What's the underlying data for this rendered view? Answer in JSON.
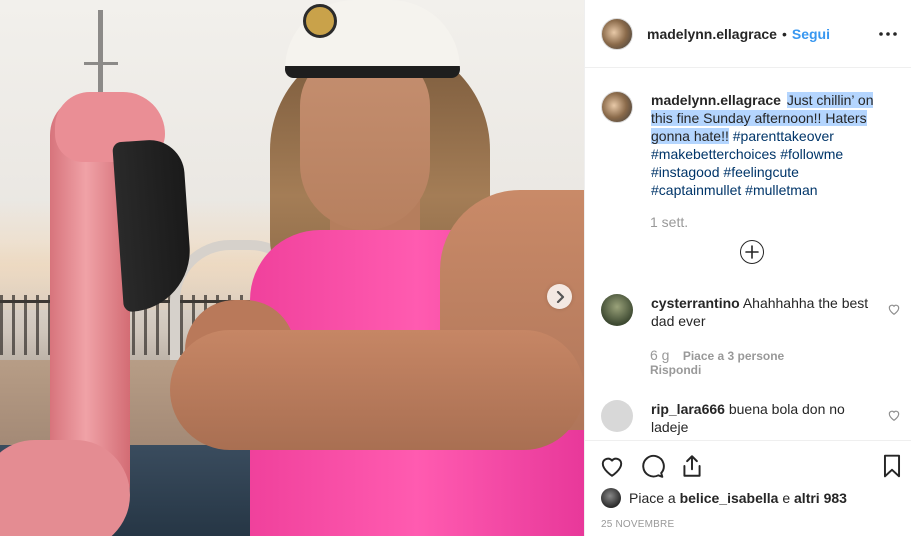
{
  "post": {
    "username": "madelynn.ellagrace",
    "separator": "•",
    "follow_label": "Segui",
    "caption": {
      "username": "madelynn.ellagrace",
      "highlighted_text_1": "Just chillin’ on this fine Sunday afternoon!! Haters gonna hate!!",
      "hashtags": [
        "#parenttakeover",
        "#makebetterchoices",
        "#followme",
        "#instagood",
        "#feelingcute",
        "#captainmullet",
        "#mulletman"
      ],
      "time": "1 sett."
    },
    "comments": [
      {
        "username": "cysterrantino",
        "text": "Ahahhahha the best dad ever",
        "age": "6 g",
        "likes": "Piace a 3 persone",
        "reply_label": "Rispondi"
      },
      {
        "username": "rip_lara666",
        "text": "buena bola don no ladeje"
      }
    ],
    "liked_by": {
      "prefix": "Piace a",
      "user": "belice_isabella",
      "connector": "e",
      "others": "altri 983"
    },
    "date": "25 novembre"
  },
  "icons": {
    "more": "more-icon",
    "next": "chevron-right-icon",
    "load_more": "plus-circle-icon",
    "like": "heart-icon",
    "comment": "comment-icon",
    "share": "share-icon",
    "save": "bookmark-icon"
  },
  "colors": {
    "follow": "#3897f0",
    "hashtag": "#003569",
    "selection": "#b4d5fe",
    "muted": "#999999",
    "shirt": "#ff5bb0"
  }
}
